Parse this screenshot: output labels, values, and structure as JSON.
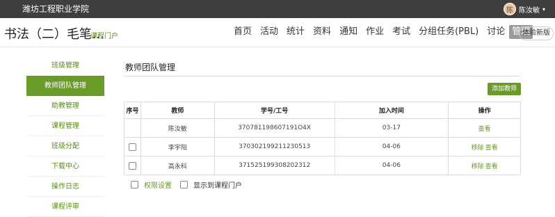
{
  "topbar": {
    "school": "潍坊工程职业学院",
    "user_name": "陈汝敏",
    "avatar_text": "陈",
    "caret": "▾"
  },
  "course": {
    "title": "书法（二）毛笔…",
    "portal_link": "课程门户"
  },
  "nav": [
    "首页",
    "活动",
    "统计",
    "资料",
    "通知",
    "作业",
    "考试",
    "分组任务(PBL)",
    "讨论",
    "管理"
  ],
  "nav_active": "管理",
  "new_version_btn": "体验新版",
  "sidebar": [
    {
      "label": "班级管理",
      "active": false
    },
    {
      "label": "教师团队管理",
      "active": true
    },
    {
      "label": "助教管理",
      "active": false
    },
    {
      "label": "课程管理",
      "active": false
    },
    {
      "label": "班级分配",
      "active": false
    },
    {
      "label": "下载中心",
      "active": false
    },
    {
      "label": "操作日志",
      "active": false
    },
    {
      "label": "课程评审",
      "active": false
    }
  ],
  "main": {
    "title": "教师团队管理",
    "add_button": "添加教师",
    "headers": [
      "序号",
      "教师",
      "学号/工号",
      "加入时间",
      "操作"
    ],
    "rows": [
      {
        "checkbox": false,
        "teacher": "陈汝敏",
        "id": "370781198607191O4X",
        "time": "03-17",
        "remove": "",
        "view": "查看"
      },
      {
        "checkbox": true,
        "teacher": "李宇阳",
        "id": "370302199211230513",
        "time": "04-06",
        "remove": "移除",
        "view": "查看"
      },
      {
        "checkbox": true,
        "teacher": "高永科",
        "id": "371525199308202312",
        "time": "04-06",
        "remove": "移除",
        "view": "查看"
      }
    ],
    "perm_label": "权限设置",
    "show_label": "显示到课程门户"
  },
  "colors": {
    "accent": "#6a9a28",
    "topbar": "#3f3f3f"
  }
}
